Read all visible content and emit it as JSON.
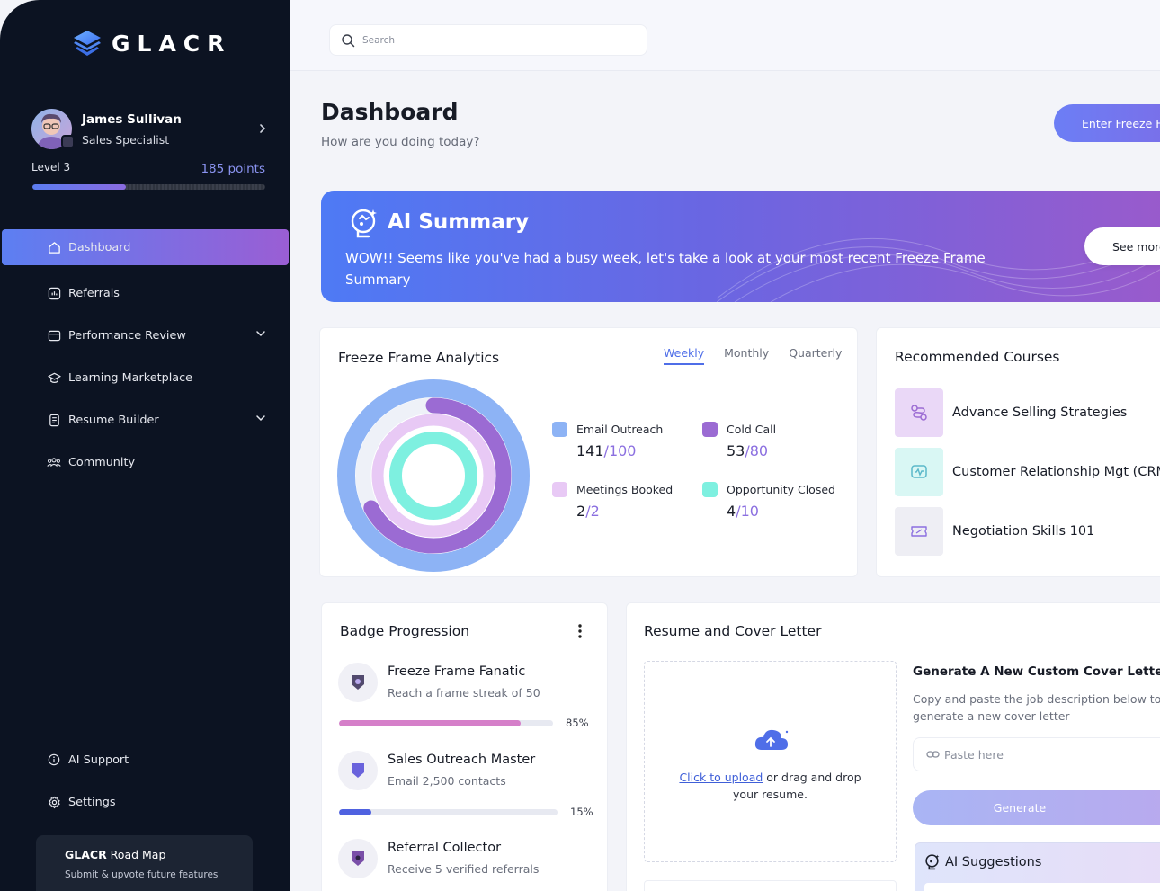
{
  "brand": {
    "name": "GLACR"
  },
  "search": {
    "placeholder": "Search"
  },
  "profile": {
    "name": "James Sullivan",
    "role": "Sales Specialist",
    "level": "Level 3",
    "points": "185 points",
    "progress": 0.4
  },
  "nav": {
    "items": [
      {
        "label": "Dashboard",
        "icon": "home-icon",
        "active": true
      },
      {
        "label": "Referrals",
        "icon": "referrals-icon"
      },
      {
        "label": "Performance Review",
        "icon": "performance-icon",
        "has_children": true
      },
      {
        "label": "Learning Marketplace",
        "icon": "graduation-cap-icon"
      },
      {
        "label": "Resume Builder",
        "icon": "resume-icon",
        "has_children": true
      },
      {
        "label": "Community",
        "icon": "community-icon"
      }
    ],
    "bottom": [
      {
        "label": "AI Support",
        "icon": "info-icon"
      },
      {
        "label": "Settings",
        "icon": "gear-icon"
      }
    ]
  },
  "roadmap": {
    "title_bold": "GLACR",
    "title_rest": " Road Map",
    "text": "Submit & upvote future features"
  },
  "header": {
    "title": "Dashboard",
    "subtitle": "How are you doing today?",
    "cta": "Enter Freeze Frame"
  },
  "ai_summary": {
    "title": "AI Summary",
    "text": "WOW!! Seems like you've had a busy week, let's take a look at your most recent Freeze Frame Summary",
    "button": "See more"
  },
  "analytics": {
    "title": "Freeze Frame Analytics",
    "tabs": [
      "Weekly",
      "Monthly",
      "Quarterly"
    ],
    "active_tab": "Weekly",
    "metrics": [
      {
        "label": "Email Outreach",
        "value": "141",
        "target": "100",
        "color": "#8db3f5"
      },
      {
        "label": "Cold Call",
        "value": "53",
        "target": "80",
        "color": "#9b6bd3"
      },
      {
        "label": "Meetings Booked",
        "value": "2",
        "target": "2",
        "color": "#e8c9f5"
      },
      {
        "label": "Opportunity Closed",
        "value": "4",
        "target": "10",
        "color": "#7ef0e0"
      }
    ]
  },
  "courses": {
    "title": "Recommended Courses",
    "items": [
      {
        "title": "Advance Selling Strategies",
        "icon": "route-icon",
        "bg": "#ead8f7"
      },
      {
        "title": "Customer Relationship Mgt (CRM)",
        "icon": "monitor-icon",
        "bg": "#d9f7f4"
      },
      {
        "title": "Negotiation Skills 101",
        "icon": "ticket-icon",
        "bg": "#eeeef4"
      }
    ]
  },
  "badges": {
    "title": "Badge Progression",
    "items": [
      {
        "name": "Freeze Frame Fanatic",
        "desc": "Reach a frame streak of 50",
        "percent": "85%",
        "progress": 0.85,
        "color": "#d57fc9"
      },
      {
        "name": "Sales Outreach Master",
        "desc": "Email 2,500 contacts",
        "percent": "15%",
        "progress": 0.15,
        "color": "#4f62e0"
      },
      {
        "name": "Referral Collector",
        "desc": "Receive 5 verified referrals"
      }
    ]
  },
  "resume": {
    "title": "Resume and Cover Letter",
    "upload_link": "Click to upload",
    "upload_rest": " or drag and drop",
    "upload_line2": "your resume.",
    "cover_title": "Generate A New Custom Cover Letter",
    "cover_desc": "Copy and paste the job description below to generate a new cover letter",
    "paste_placeholder": "Paste here",
    "generate": "Generate",
    "suggestions_title": "AI Suggestions"
  }
}
